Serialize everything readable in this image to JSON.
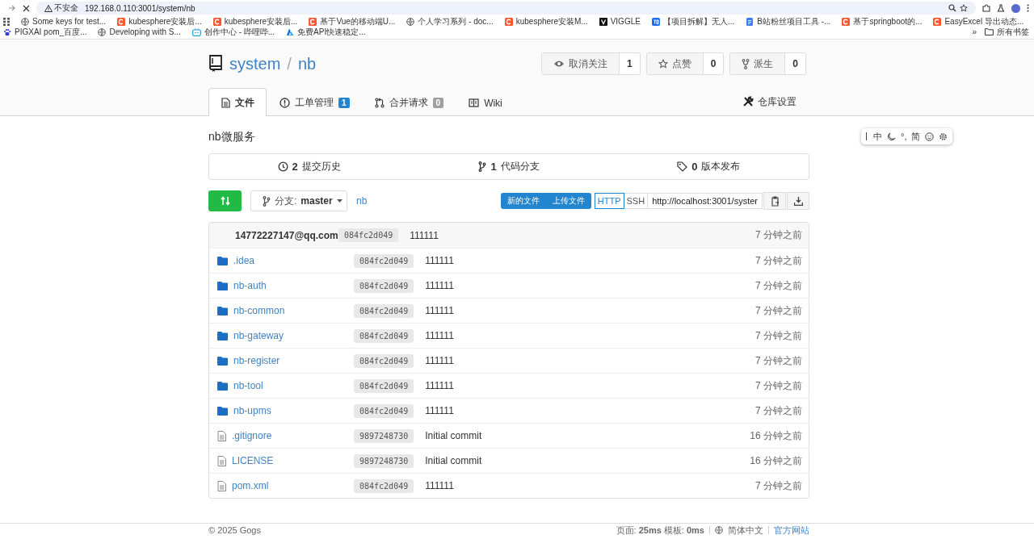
{
  "browser": {
    "security": "不安全",
    "url": "192.168.0.110:3001/system/nb",
    "bookmarks": [
      {
        "kind": "globe",
        "label": "Some keys for test..."
      },
      {
        "kind": "csdn",
        "label": "kubesphere安装后..."
      },
      {
        "kind": "csdn",
        "label": "kubesphere安装后..."
      },
      {
        "kind": "csdn",
        "label": "基于Vue的移动端U..."
      },
      {
        "kind": "globe",
        "label": "个人学习系列 - doc..."
      },
      {
        "kind": "csdn",
        "label": "kubesphere安装M..."
      },
      {
        "kind": "dark",
        "label": "VIGGLE"
      },
      {
        "kind": "zhihu",
        "label": "【项目拆解】无人..."
      },
      {
        "kind": "doc",
        "label": "B站粉丝项目工具 -..."
      },
      {
        "kind": "csdn",
        "label": "基于springboot的..."
      },
      {
        "kind": "csdn",
        "label": "EasyExcel 导出动态..."
      },
      {
        "kind": "paw",
        "label": "PIGXAI pom_百度..."
      },
      {
        "kind": "globe",
        "label": "Developing with S..."
      },
      {
        "kind": "tv",
        "label": "创作中心 - 哔哩哔..."
      },
      {
        "kind": "azure",
        "label": "免费API快速稳定..."
      }
    ],
    "more": "»",
    "all_bookmarks": "所有书签"
  },
  "repo": {
    "owner": "system",
    "separator": "/",
    "name": "nb",
    "actions": [
      {
        "kind": "eye",
        "label": "取消关注",
        "count": "1"
      },
      {
        "kind": "star",
        "label": "点赞",
        "count": "0"
      },
      {
        "kind": "fork",
        "label": "派生",
        "count": "0"
      }
    ],
    "tabs": [
      {
        "kind": "file",
        "label": "文件",
        "selected": true
      },
      {
        "kind": "issue",
        "label": "工单管理",
        "badge": "1",
        "color": "#2185d0",
        "selected": false
      },
      {
        "kind": "pr",
        "label": "合并请求",
        "badge": "0",
        "color": "#a0a0a0",
        "selected": false
      },
      {
        "kind": "book",
        "label": "Wiki",
        "selected": false
      }
    ],
    "settings": "仓库设置"
  },
  "ime_toolbar": {
    "items": [
      {
        "kind": "text",
        "label": "中"
      },
      {
        "kind": "moon"
      },
      {
        "kind": "text",
        "label": "°,"
      },
      {
        "kind": "text",
        "label": "简"
      },
      {
        "kind": "smile"
      },
      {
        "kind": "gear"
      }
    ]
  },
  "description": "nb微服务",
  "stats": [
    {
      "kind": "history",
      "count": "2",
      "label": "提交历史"
    },
    {
      "kind": "branch",
      "count": "1",
      "label": "代码分支"
    },
    {
      "kind": "tag",
      "count": "0",
      "label": "版本发布"
    }
  ],
  "toolbar": {
    "branch_prefix": "分支:",
    "branch": "master",
    "path": "nb",
    "new_file": "新的文件",
    "upload_file": "上传文件",
    "protocols": [
      {
        "label": "HTTP",
        "selected": true
      },
      {
        "label": "SSH",
        "selected": false
      }
    ],
    "clone_url": "http://localhost:3001/syster"
  },
  "latest_commit": {
    "author": "14772227147@qq.com",
    "sha": "084fc2d049",
    "message": "111111",
    "time": "7 分钟之前"
  },
  "files": [
    {
      "kind": "dir",
      "name": ".idea",
      "sha": "084fc2d049",
      "message": "111111",
      "time": "7 分钟之前"
    },
    {
      "kind": "dir",
      "name": "nb-auth",
      "sha": "084fc2d049",
      "message": "111111",
      "time": "7 分钟之前"
    },
    {
      "kind": "dir",
      "name": "nb-common",
      "sha": "084fc2d049",
      "message": "111111",
      "time": "7 分钟之前"
    },
    {
      "kind": "dir",
      "name": "nb-gateway",
      "sha": "084fc2d049",
      "message": "111111",
      "time": "7 分钟之前"
    },
    {
      "kind": "dir",
      "name": "nb-register",
      "sha": "084fc2d049",
      "message": "111111",
      "time": "7 分钟之前"
    },
    {
      "kind": "dir",
      "name": "nb-tool",
      "sha": "084fc2d049",
      "message": "111111",
      "time": "7 分钟之前"
    },
    {
      "kind": "dir",
      "name": "nb-upms",
      "sha": "084fc2d049",
      "message": "111111",
      "time": "7 分钟之前"
    },
    {
      "kind": "file",
      "name": ".gitignore",
      "sha": "9897248730",
      "message": "Initial commit",
      "time": "16 分钟之前"
    },
    {
      "kind": "file",
      "name": "LICENSE",
      "sha": "9897248730",
      "message": "Initial commit",
      "time": "16 分钟之前"
    },
    {
      "kind": "file",
      "name": "pom.xml",
      "sha": "084fc2d049",
      "message": "111111",
      "time": "7 分钟之前"
    }
  ],
  "footer": {
    "copyright": "© 2025 Gogs",
    "timing": "页面: **25ms** 模板: **0ms**",
    "language": "简体中文",
    "website": "官方网站"
  }
}
